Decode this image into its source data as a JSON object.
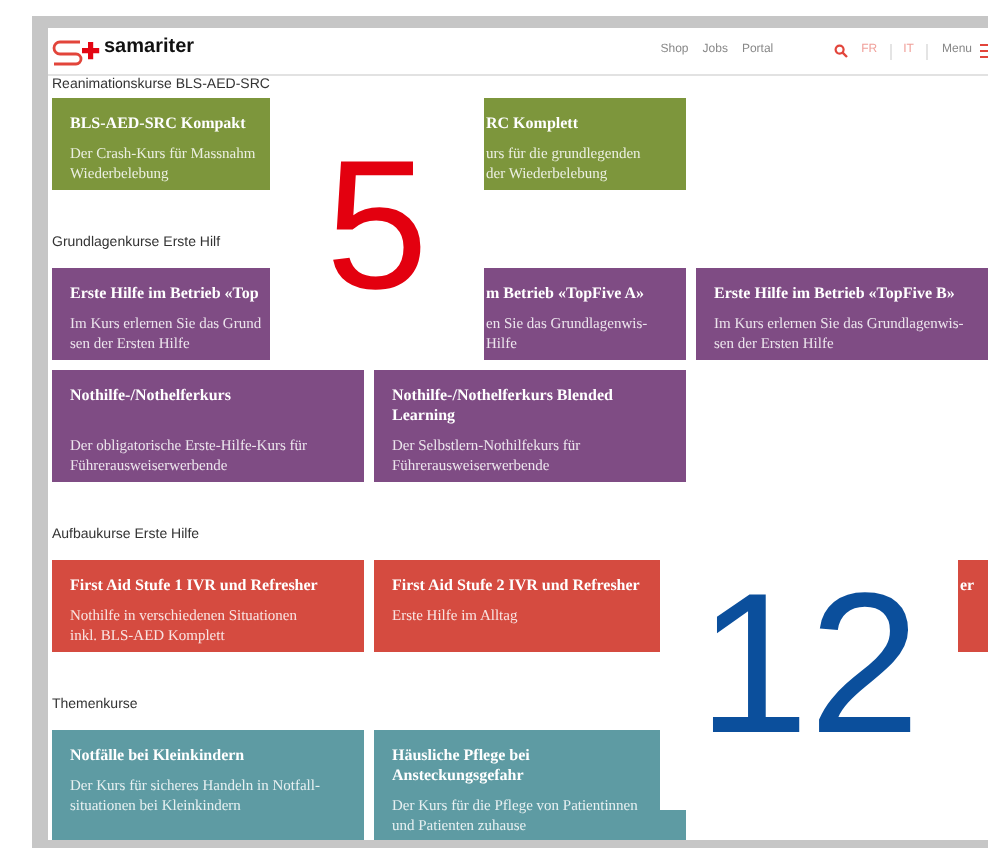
{
  "header": {
    "logo": "samariter",
    "nav": [
      "Shop",
      "Jobs",
      "Portal"
    ],
    "languages": [
      {
        "label": "FR"
      },
      {
        "label": "IT"
      }
    ],
    "menu": "Menu"
  },
  "sections": [
    {
      "title": "Reanimationskurse BLS-AED-SRC",
      "color": "#7d963c",
      "cards": [
        {
          "title": "BLS-AED-SRC Kompakt",
          "lines": [
            "Der Crash-Kurs für Massnahm",
            "Wiederbelebung"
          ]
        },
        {
          "title": "RC Komplett",
          "lines": [
            "urs für die grundlegenden",
            "der Wiederbelebung"
          ]
        }
      ]
    },
    {
      "title": "Grundlagenkurse Erste Hilf",
      "color": "#7f4c84",
      "cards": [
        {
          "title": "Erste Hilfe im Betrieb «Top",
          "lines": [
            "Im Kurs erlernen Sie das Grund",
            "sen der Ersten Hilfe"
          ]
        },
        {
          "title": "m Betrieb «TopFive A»",
          "lines": [
            "en Sie das Grundlagenwis-",
            "Hilfe"
          ]
        },
        {
          "title": "Erste Hilfe im Betrieb «TopFive B»",
          "lines": [
            "Im Kurs erlernen Sie das Grundlagenwis-",
            "sen der Ersten Hilfe"
          ]
        },
        {
          "title": "Nothilfe-/Nothelferkurs",
          "lines": [
            "Der obligatorische Erste-Hilfe-Kurs für",
            "Führerausweiserwerbende"
          ]
        },
        {
          "title": "Nothilfe-/Nothelferkurs Blended Learning",
          "lines": [
            "Der Selbstlern-Nothilfekurs für",
            "Führerausweiserwerbende"
          ]
        }
      ]
    },
    {
      "title": "Aufbaukurse Erste Hilfe",
      "color": "#d54b40",
      "cards": [
        {
          "title": "First Aid Stufe 1 IVR und Refresher",
          "lines": [
            "Nothilfe in verschiedenen Situationen",
            "inkl. BLS-AED Komplett"
          ]
        },
        {
          "title": "First Aid Stufe 2 IVR und Refresher",
          "lines": [
            "Erste Hilfe im Alltag"
          ]
        },
        {
          "title": "er"
        }
      ]
    },
    {
      "title": "Themenkurse",
      "color": "#5e9ba3",
      "cards": [
        {
          "title": "Notfälle bei Kleinkindern",
          "lines": [
            "Der Kurs für sicheres Handeln in Notfall-",
            "situationen bei Kleinkindern"
          ]
        },
        {
          "title": "Häusliche Pflege bei Ansteckungsgefahr",
          "lines": [
            "Der Kurs für die Pflege von Patientinnen",
            "und Patienten zuhause"
          ]
        }
      ]
    }
  ],
  "callouts": [
    {
      "label": "5",
      "color": "#e3000f"
    },
    {
      "label": "12",
      "color": "#0b4f9c"
    }
  ]
}
